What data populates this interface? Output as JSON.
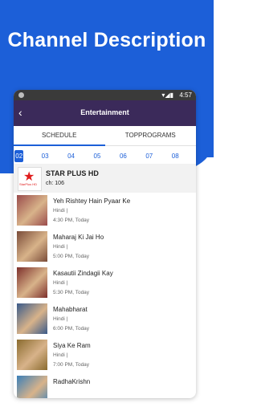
{
  "headline": "Channel Description",
  "status": {
    "time": "4:57"
  },
  "appbar": {
    "title": "Entertainment"
  },
  "tabs": [
    {
      "label": "SCHEDULE"
    },
    {
      "label": "TOPPROGRAMS"
    }
  ],
  "days": [
    "02",
    "03",
    "04",
    "05",
    "06",
    "07",
    "08"
  ],
  "channel": {
    "logo_text": "StarPlus HD",
    "name": "STAR PLUS HD",
    "number": "ch: 106"
  },
  "programs": [
    {
      "name": "Yeh Rishtey Hain Pyaar Ke",
      "lang": "Hindi |",
      "time": "4:30 PM, Today",
      "color": "#9a4b4b"
    },
    {
      "name": "Maharaj Ki Jai Ho",
      "lang": "Hindi |",
      "time": "5:00 PM, Today",
      "color": "#7a4b38"
    },
    {
      "name": "Kasautii Zindagii Kay",
      "lang": "Hindi |",
      "time": "5:30 PM, Today",
      "color": "#7d2f2b"
    },
    {
      "name": "Mahabharat",
      "lang": "Hindi |",
      "time": "6:00 PM, Today",
      "color": "#3a5a8a"
    },
    {
      "name": "Siya Ke Ram",
      "lang": "Hindi |",
      "time": "7:00 PM, Today",
      "color": "#8a6b2e"
    },
    {
      "name": "RadhaKrishn",
      "lang": "",
      "time": "",
      "color": "#3b7fb8"
    }
  ]
}
